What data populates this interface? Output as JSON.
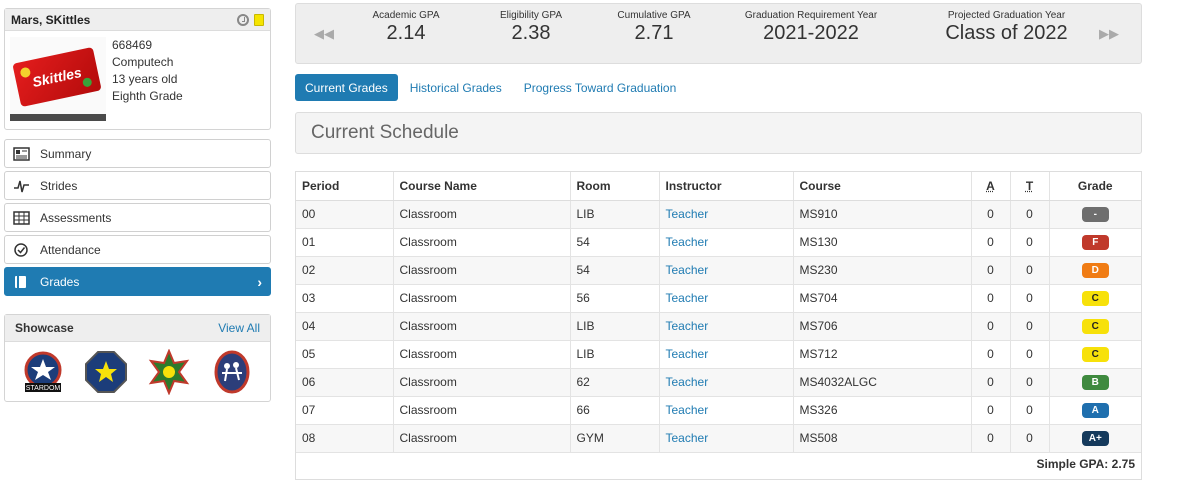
{
  "student": {
    "name": "Mars, SKittles",
    "id": "668469",
    "school": "Computech",
    "age": "13 years old",
    "grade_level": "Eighth Grade",
    "photo_label": "Skittles"
  },
  "nav": {
    "items": [
      {
        "label": "Summary",
        "icon": "summary-icon"
      },
      {
        "label": "Strides",
        "icon": "strides-icon"
      },
      {
        "label": "Assessments",
        "icon": "assessments-icon"
      },
      {
        "label": "Attendance",
        "icon": "attendance-icon"
      },
      {
        "label": "Grades",
        "icon": "grades-icon",
        "active": true
      }
    ]
  },
  "showcase": {
    "title": "Showcase",
    "view_all": "View All",
    "badges": [
      {
        "icon": "stardom-badge-icon",
        "text": "STARDOM"
      },
      {
        "icon": "star-octagon-badge-icon"
      },
      {
        "icon": "sun-star-badge-icon"
      },
      {
        "icon": "team-badge-icon"
      }
    ]
  },
  "gpa": {
    "items": [
      {
        "label": "Academic GPA",
        "value": "2.14"
      },
      {
        "label": "Eligibility GPA",
        "value": "2.38"
      },
      {
        "label": "Cumulative GPA",
        "value": "2.71"
      },
      {
        "label": "Graduation Requirement Year",
        "value": "2021-2022"
      },
      {
        "label": "Projected Graduation Year",
        "value": "Class of 2022"
      }
    ]
  },
  "tabs": [
    {
      "label": "Current Grades",
      "active": true
    },
    {
      "label": "Historical Grades"
    },
    {
      "label": "Progress Toward Graduation"
    }
  ],
  "schedule_title": "Current Schedule",
  "table": {
    "headers": [
      "Period",
      "Course Name",
      "Room",
      "Instructor",
      "Course",
      "A",
      "T",
      "Grade"
    ],
    "rows": [
      {
        "period": "00",
        "course_name": "Classroom",
        "room": "LIB",
        "instructor": "Teacher",
        "course": "MS910",
        "a": "0",
        "t": "0",
        "grade": "-",
        "grade_color": "#6e6e6e"
      },
      {
        "period": "01",
        "course_name": "Classroom",
        "room": "54",
        "instructor": "Teacher",
        "course": "MS130",
        "a": "0",
        "t": "0",
        "grade": "F",
        "grade_color": "#c0392b"
      },
      {
        "period": "02",
        "course_name": "Classroom",
        "room": "54",
        "instructor": "Teacher",
        "course": "MS230",
        "a": "0",
        "t": "0",
        "grade": "D",
        "grade_color": "#f07c14"
      },
      {
        "period": "03",
        "course_name": "Classroom",
        "room": "56",
        "instructor": "Teacher",
        "course": "MS704",
        "a": "0",
        "t": "0",
        "grade": "C",
        "grade_color": "#f7e10a"
      },
      {
        "period": "04",
        "course_name": "Classroom",
        "room": "LIB",
        "instructor": "Teacher",
        "course": "MS706",
        "a": "0",
        "t": "0",
        "grade": "C",
        "grade_color": "#f7e10a"
      },
      {
        "period": "05",
        "course_name": "Classroom",
        "room": "LIB",
        "instructor": "Teacher",
        "course": "MS712",
        "a": "0",
        "t": "0",
        "grade": "C",
        "grade_color": "#f7e10a"
      },
      {
        "period": "06",
        "course_name": "Classroom",
        "room": "62",
        "instructor": "Teacher",
        "course": "MS4032ALGC",
        "a": "0",
        "t": "0",
        "grade": "B",
        "grade_color": "#3f8a3f"
      },
      {
        "period": "07",
        "course_name": "Classroom",
        "room": "66",
        "instructor": "Teacher",
        "course": "MS326",
        "a": "0",
        "t": "0",
        "grade": "A",
        "grade_color": "#1f6fae"
      },
      {
        "period": "08",
        "course_name": "Classroom",
        "room": "GYM",
        "instructor": "Teacher",
        "course": "MS508",
        "a": "0",
        "t": "0",
        "grade": "A+",
        "grade_color": "#153a5c"
      }
    ]
  },
  "simple_gpa": "Simple GPA: 2.75",
  "colors": {
    "accent": "#1f7bb2",
    "panel_bg": "#eeeeee"
  }
}
